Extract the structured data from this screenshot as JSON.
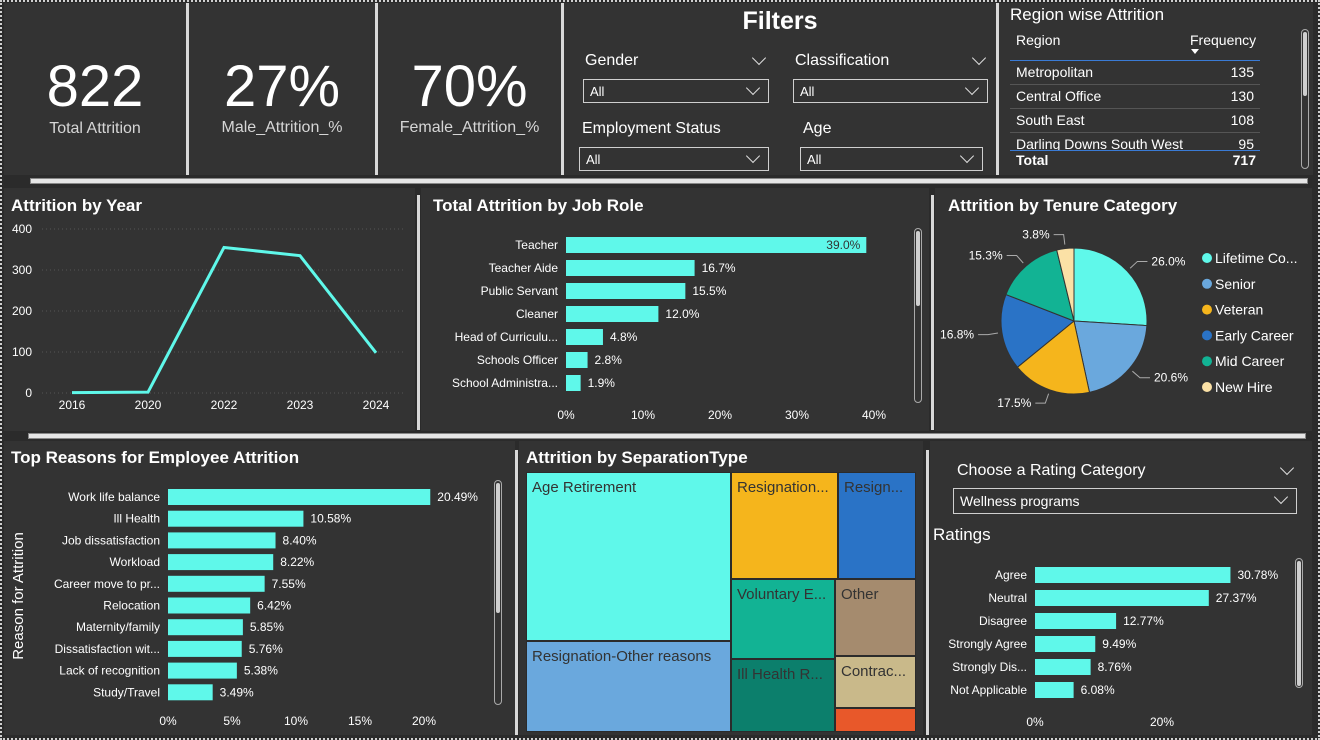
{
  "kpis": [
    {
      "value": "822",
      "label": "Total Attrition"
    },
    {
      "value": "27%",
      "label": "Male_Attrition_%"
    },
    {
      "value": "70%",
      "label": "Female_Attrition_%"
    }
  ],
  "filters": {
    "title": "Filters",
    "gender": {
      "label": "Gender",
      "value": "All"
    },
    "classification": {
      "label": "Classification",
      "value": "All"
    },
    "employment_status": {
      "label": "Employment Status",
      "value": "All"
    },
    "age": {
      "label": "Age",
      "value": "All"
    }
  },
  "region_table": {
    "title": "Region wise Attrition",
    "col_region": "Region",
    "col_frequency": "Frequency",
    "rows": [
      {
        "region": "Metropolitan",
        "frequency": "135"
      },
      {
        "region": "Central Office",
        "frequency": "130"
      },
      {
        "region": "South East",
        "frequency": "108"
      },
      {
        "region": "Darling Downs South West",
        "frequency": "95"
      }
    ],
    "total_label": "Total",
    "total_value": "717"
  },
  "rating": {
    "choose_label": "Choose a Rating Category",
    "selected": "Wellness programs"
  },
  "colors": {
    "accent": "#5ff8ea",
    "background": "#2b2b2b",
    "panel": "#333333"
  },
  "chart_data": [
    {
      "id": "year",
      "type": "line",
      "title": "Attrition by Year",
      "x": [
        "2016",
        "2020",
        "2022",
        "2023",
        "2024"
      ],
      "values": [
        1,
        2,
        355,
        335,
        98
      ],
      "ylim": [
        0,
        400
      ],
      "yticks": [
        0,
        100,
        200,
        300,
        400
      ],
      "grid": true
    },
    {
      "id": "jobrole",
      "type": "bar",
      "title": "Total Attrition by Job Role",
      "categories": [
        "Teacher",
        "Teacher Aide",
        "Public Servant",
        "Cleaner",
        "Head of Curriculu...",
        "Schools Officer",
        "School Administra..."
      ],
      "values": [
        39.0,
        16.7,
        15.5,
        12.0,
        4.8,
        2.8,
        1.9
      ],
      "labels": [
        "39.0%",
        "16.7%",
        "15.5%",
        "12.0%",
        "4.8%",
        "2.8%",
        "1.9%"
      ],
      "xticks": [
        "0%",
        "10%",
        "20%",
        "30%",
        "40%"
      ],
      "xlim": [
        0,
        40
      ]
    },
    {
      "id": "tenure",
      "type": "pie",
      "title": "Attrition by Tenure Category",
      "categories": [
        "Lifetime Co...",
        "Senior",
        "Veteran",
        "Early Career",
        "Mid Career",
        "New Hire"
      ],
      "values": [
        26.0,
        20.6,
        17.5,
        16.8,
        15.3,
        3.8
      ],
      "labels": [
        "26.0%",
        "20.6%",
        "17.5%",
        "16.8%",
        "15.3%",
        "3.8%"
      ],
      "colors": [
        "#5ff8ea",
        "#6aa8dd",
        "#f5b51c",
        "#2a73c6",
        "#12b394",
        "#fbe1a6"
      ],
      "legend": "right"
    },
    {
      "id": "reasons",
      "type": "bar",
      "title": "Top Reasons for Employee Attrition",
      "ylabel": "Reason for Attrition",
      "categories": [
        "Work life balance",
        "Ill Health",
        "Job dissatisfaction",
        "Workload",
        "Career move to pr...",
        "Relocation",
        "Maternity/family",
        "Dissatisfaction wit...",
        "Lack of recognition",
        "Study/Travel"
      ],
      "values": [
        20.49,
        10.58,
        8.4,
        8.22,
        7.55,
        6.42,
        5.85,
        5.76,
        5.38,
        3.49
      ],
      "labels": [
        "20.49%",
        "10.58%",
        "8.40%",
        "8.22%",
        "7.55%",
        "6.42%",
        "5.85%",
        "5.76%",
        "5.38%",
        "3.49%"
      ],
      "xticks": [
        "0%",
        "5%",
        "10%",
        "15%",
        "20%"
      ],
      "xlim": [
        0,
        20
      ]
    },
    {
      "id": "separation",
      "type": "treemap",
      "title": "Attrition by SeparationType",
      "categories": [
        "Age Retirement",
        "Resignation-Other reasons",
        "Resignation...",
        "Resign...",
        "Voluntary E...",
        "Other",
        "Ill Health R...",
        "Contrac...",
        ""
      ],
      "colors": [
        "#5ff8ea",
        "#6aa8dd",
        "#f5b51c",
        "#2a73c6",
        "#12b394",
        "#a58b6e",
        "#0c7f6c",
        "#c9b98a",
        "#e8582a"
      ]
    },
    {
      "id": "ratings",
      "type": "bar",
      "title": "Ratings",
      "categories": [
        "Agree",
        "Neutral",
        "Disagree",
        "Strongly Agree",
        "Strongly Dis...",
        "Not Applicable"
      ],
      "values": [
        30.78,
        27.37,
        12.77,
        9.49,
        8.76,
        6.08
      ],
      "labels": [
        "30.78%",
        "27.37%",
        "12.77%",
        "9.49%",
        "8.76%",
        "6.08%"
      ],
      "xticks": [
        "0%",
        "20%"
      ],
      "xlim": [
        0,
        20
      ]
    }
  ]
}
